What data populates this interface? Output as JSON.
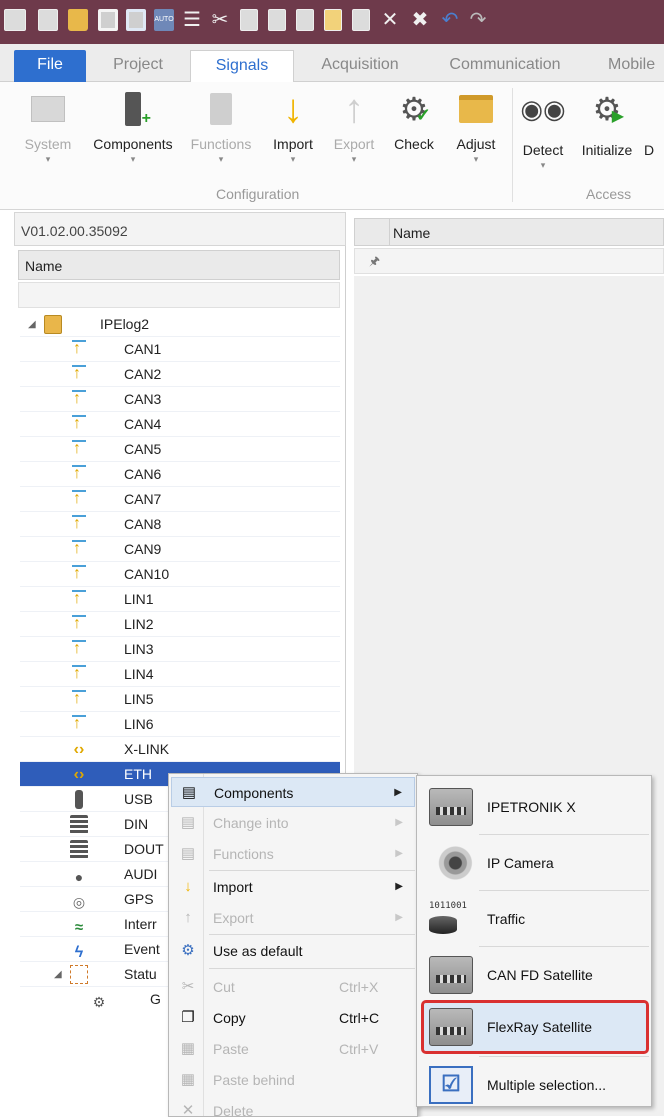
{
  "quick_access": {
    "icons": [
      "app-icon",
      "new-icon",
      "open-folder-icon",
      "save-icon",
      "save-as-icon",
      "auto-icon",
      "sort-icon",
      "cut-icon",
      "copy-icon",
      "paste-icon",
      "paste-behind-icon",
      "doc-icon",
      "export-icon",
      "delete-icon",
      "delete-all-icon",
      "undo-icon",
      "redo-icon"
    ],
    "auto_label": "AUTO"
  },
  "tabs": [
    "File",
    "Project",
    "Signals",
    "Acquisition",
    "Communication",
    "Mobile"
  ],
  "active_tab": "Signals",
  "ribbon": {
    "buttons": [
      {
        "label": "System",
        "disabled": true
      },
      {
        "label": "Components",
        "disabled": false
      },
      {
        "label": "Functions",
        "disabled": true
      },
      {
        "label": "Import",
        "disabled": false
      },
      {
        "label": "Export",
        "disabled": true
      },
      {
        "label": "Check",
        "disabled": false
      },
      {
        "label": "Adjust",
        "disabled": false
      },
      {
        "label": "Detect",
        "disabled": false
      },
      {
        "label": "Initialize",
        "disabled": false
      },
      {
        "label": "D",
        "disabled": false
      }
    ],
    "groups": [
      "Configuration",
      "Access"
    ]
  },
  "left_panel": {
    "version": "V01.02.00.35092",
    "column_header": "Name",
    "tree": [
      {
        "label": "IPElog2",
        "icon": "logger-icon",
        "level": 0,
        "expanded": true
      },
      {
        "label": "CAN1",
        "icon": "bus-icon",
        "level": 1
      },
      {
        "label": "CAN2",
        "icon": "bus-icon",
        "level": 1
      },
      {
        "label": "CAN3",
        "icon": "bus-icon",
        "level": 1
      },
      {
        "label": "CAN4",
        "icon": "bus-icon",
        "level": 1
      },
      {
        "label": "CAN5",
        "icon": "bus-icon",
        "level": 1
      },
      {
        "label": "CAN6",
        "icon": "bus-icon",
        "level": 1
      },
      {
        "label": "CAN7",
        "icon": "bus-icon",
        "level": 1
      },
      {
        "label": "CAN8",
        "icon": "bus-icon",
        "level": 1
      },
      {
        "label": "CAN9",
        "icon": "bus-icon",
        "level": 1
      },
      {
        "label": "CAN10",
        "icon": "bus-icon",
        "level": 1
      },
      {
        "label": "LIN1",
        "icon": "bus-icon",
        "level": 1
      },
      {
        "label": "LIN2",
        "icon": "bus-icon",
        "level": 1
      },
      {
        "label": "LIN3",
        "icon": "bus-icon",
        "level": 1
      },
      {
        "label": "LIN4",
        "icon": "bus-icon",
        "level": 1
      },
      {
        "label": "LIN5",
        "icon": "bus-icon",
        "level": 1
      },
      {
        "label": "LIN6",
        "icon": "bus-icon",
        "level": 1
      },
      {
        "label": "X-LINK",
        "icon": "link-icon",
        "level": 1
      },
      {
        "label": "ETH",
        "icon": "link-icon",
        "level": 1,
        "selected": true
      },
      {
        "label": "USB",
        "icon": "usb-icon",
        "level": 1
      },
      {
        "label": "DIN",
        "icon": "digital-in-icon",
        "level": 1
      },
      {
        "label": "DOUT",
        "icon": "digital-out-icon",
        "level": 1
      },
      {
        "label": "AUDI",
        "icon": "microphone-icon",
        "level": 1
      },
      {
        "label": "GPS",
        "icon": "gps-icon",
        "level": 1
      },
      {
        "label": "Interr",
        "icon": "internal-icon",
        "level": 1
      },
      {
        "label": "Event",
        "icon": "event-icon",
        "level": 1
      },
      {
        "label": "Statu",
        "icon": "status-icon",
        "level": 1,
        "expanded": true
      },
      {
        "label": "G",
        "icon": "group-icon",
        "level": 2
      }
    ]
  },
  "right_panel": {
    "column_header": "Name"
  },
  "context_menu": {
    "items": [
      {
        "label": "Components",
        "shortcut": "",
        "submenu": true,
        "disabled": false,
        "highlighted": true,
        "icon": "components-icon"
      },
      {
        "label": "Change into",
        "shortcut": "",
        "submenu": true,
        "disabled": true,
        "icon": "change-into-icon"
      },
      {
        "label": "Functions",
        "shortcut": "",
        "submenu": true,
        "disabled": true,
        "icon": "functions-icon"
      },
      {
        "label": "Import",
        "shortcut": "",
        "submenu": true,
        "disabled": false,
        "icon": "import-icon"
      },
      {
        "label": "Export",
        "shortcut": "",
        "submenu": true,
        "disabled": true,
        "icon": "export-icon"
      },
      {
        "label": "Use as default",
        "shortcut": "",
        "submenu": false,
        "disabled": false,
        "icon": "use-default-icon"
      },
      {
        "label": "Cut",
        "shortcut": "Ctrl+X",
        "submenu": false,
        "disabled": true,
        "icon": "cut-icon"
      },
      {
        "label": "Copy",
        "shortcut": "Ctrl+C",
        "submenu": false,
        "disabled": false,
        "icon": "copy-icon"
      },
      {
        "label": "Paste",
        "shortcut": "Ctrl+V",
        "submenu": false,
        "disabled": true,
        "icon": "paste-icon"
      },
      {
        "label": "Paste behind",
        "shortcut": "",
        "submenu": false,
        "disabled": true,
        "icon": "paste-behind-icon"
      },
      {
        "label": "Delete",
        "shortcut": "",
        "submenu": false,
        "disabled": true,
        "icon": "delete-icon"
      }
    ]
  },
  "submenu": {
    "items": [
      {
        "label": "IPETRONIK X",
        "icon": "ipetronik-x-icon"
      },
      {
        "label": "IP Camera",
        "icon": "ip-camera-icon"
      },
      {
        "label": "Traffic",
        "icon": "traffic-icon"
      },
      {
        "label": "CAN FD Satellite",
        "icon": "can-fd-satellite-icon"
      },
      {
        "label": "FlexRay Satellite",
        "icon": "flexray-satellite-icon",
        "focused": true
      },
      {
        "label": "Multiple selection...",
        "icon": "multiple-selection-icon"
      }
    ],
    "traffic_digits": "1011001"
  },
  "colors": {
    "title_bar": "#6e3a4b",
    "file_tab": "#2e6fcf",
    "selection": "#2f5dba",
    "menu_highlight": "#dce8f5",
    "focus_outline": "#d93030"
  }
}
